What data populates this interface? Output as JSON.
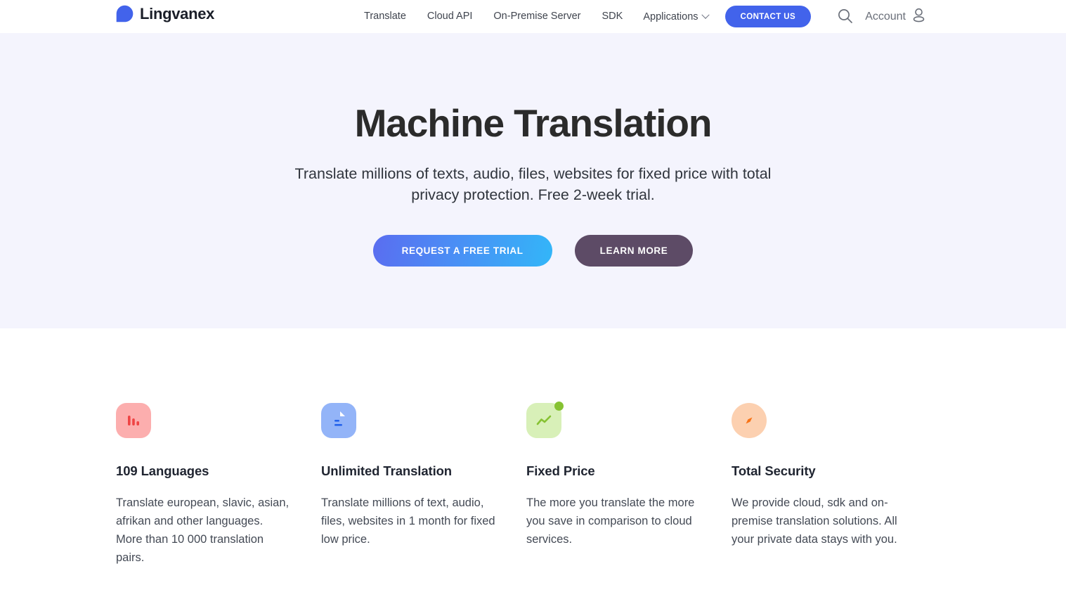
{
  "header": {
    "brand": {
      "name": "Lingvanex",
      "logo_icon": "speech-bubble-logo-icon",
      "color": "#4263eb"
    },
    "nav": [
      {
        "label": "Translate"
      },
      {
        "label": "Cloud API"
      },
      {
        "label": "On-Premise Server"
      },
      {
        "label": "SDK"
      }
    ],
    "dropdown": {
      "label": "Applications",
      "icon": "chevron-down-icon"
    },
    "contact_button": {
      "label": "CONTACT US",
      "color": "#4263eb"
    },
    "search_icon": "search-icon",
    "account": {
      "label": "Account",
      "icon": "user-icon"
    }
  },
  "hero": {
    "title": "Machine Translation",
    "subtitle": "Translate millions of texts, audio, files, websites for fixed price with total privacy protection. Free 2-week trial.",
    "background": "#f4f4fd",
    "primary_button": {
      "label": "REQUEST A FREE TRIAL",
      "gradient_from": "#5a6df0",
      "gradient_to": "#33b6f8"
    },
    "secondary_button": {
      "label": "LEARN MORE",
      "color": "#5d4b66"
    }
  },
  "features": [
    {
      "icon": "bar-chart-icon",
      "icon_bg": "#fcaeae",
      "icon_fg": "#ef4444",
      "title": "109 Languages",
      "text": "Translate european, slavic, asian, afrikan and other languages. More than 10 000 translation pairs."
    },
    {
      "icon": "document-icon",
      "icon_bg": "#93b4f8",
      "icon_fg": "#2563eb",
      "title": "Unlimited Translation",
      "text": "Translate millions of text, audio, files, websites in 1 month for fixed low price."
    },
    {
      "icon": "trend-up-icon",
      "icon_bg": "#d8f0b8",
      "icon_fg": "#86c232",
      "title": "Fixed Price",
      "text": "The more you translate the more you save in comparison to cloud services."
    },
    {
      "icon": "compass-icon",
      "icon_bg": "#fcd0b0",
      "icon_fg": "#f97316",
      "title": "Total Security",
      "text": "We provide cloud, sdk and on-premise translation solutions. All your private data stays with you."
    }
  ]
}
